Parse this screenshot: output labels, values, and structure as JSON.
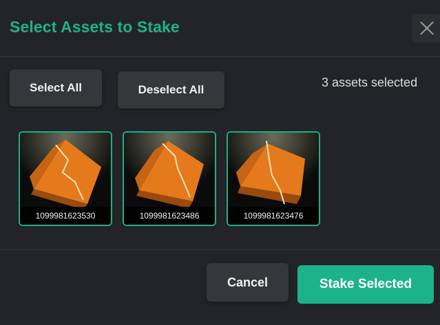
{
  "dialog": {
    "title": "Select Assets to Stake",
    "close_icon": "close-icon"
  },
  "toolbar": {
    "select_all_label": "Select All",
    "deselect_all_label": "Deselect All",
    "selection_count": "3 assets selected"
  },
  "assets": [
    {
      "id": "1099981623530",
      "selected": true,
      "thumbnail_icon": "orange-cube-image"
    },
    {
      "id": "1099981623486",
      "selected": true,
      "thumbnail_icon": "orange-cube-image"
    },
    {
      "id": "1099981623476",
      "selected": true,
      "thumbnail_icon": "orange-cube-image"
    }
  ],
  "footer": {
    "cancel_label": "Cancel",
    "stake_label": "Stake Selected"
  },
  "colors": {
    "accent": "#1db38a",
    "background": "#232427",
    "button_secondary": "#35373b"
  }
}
